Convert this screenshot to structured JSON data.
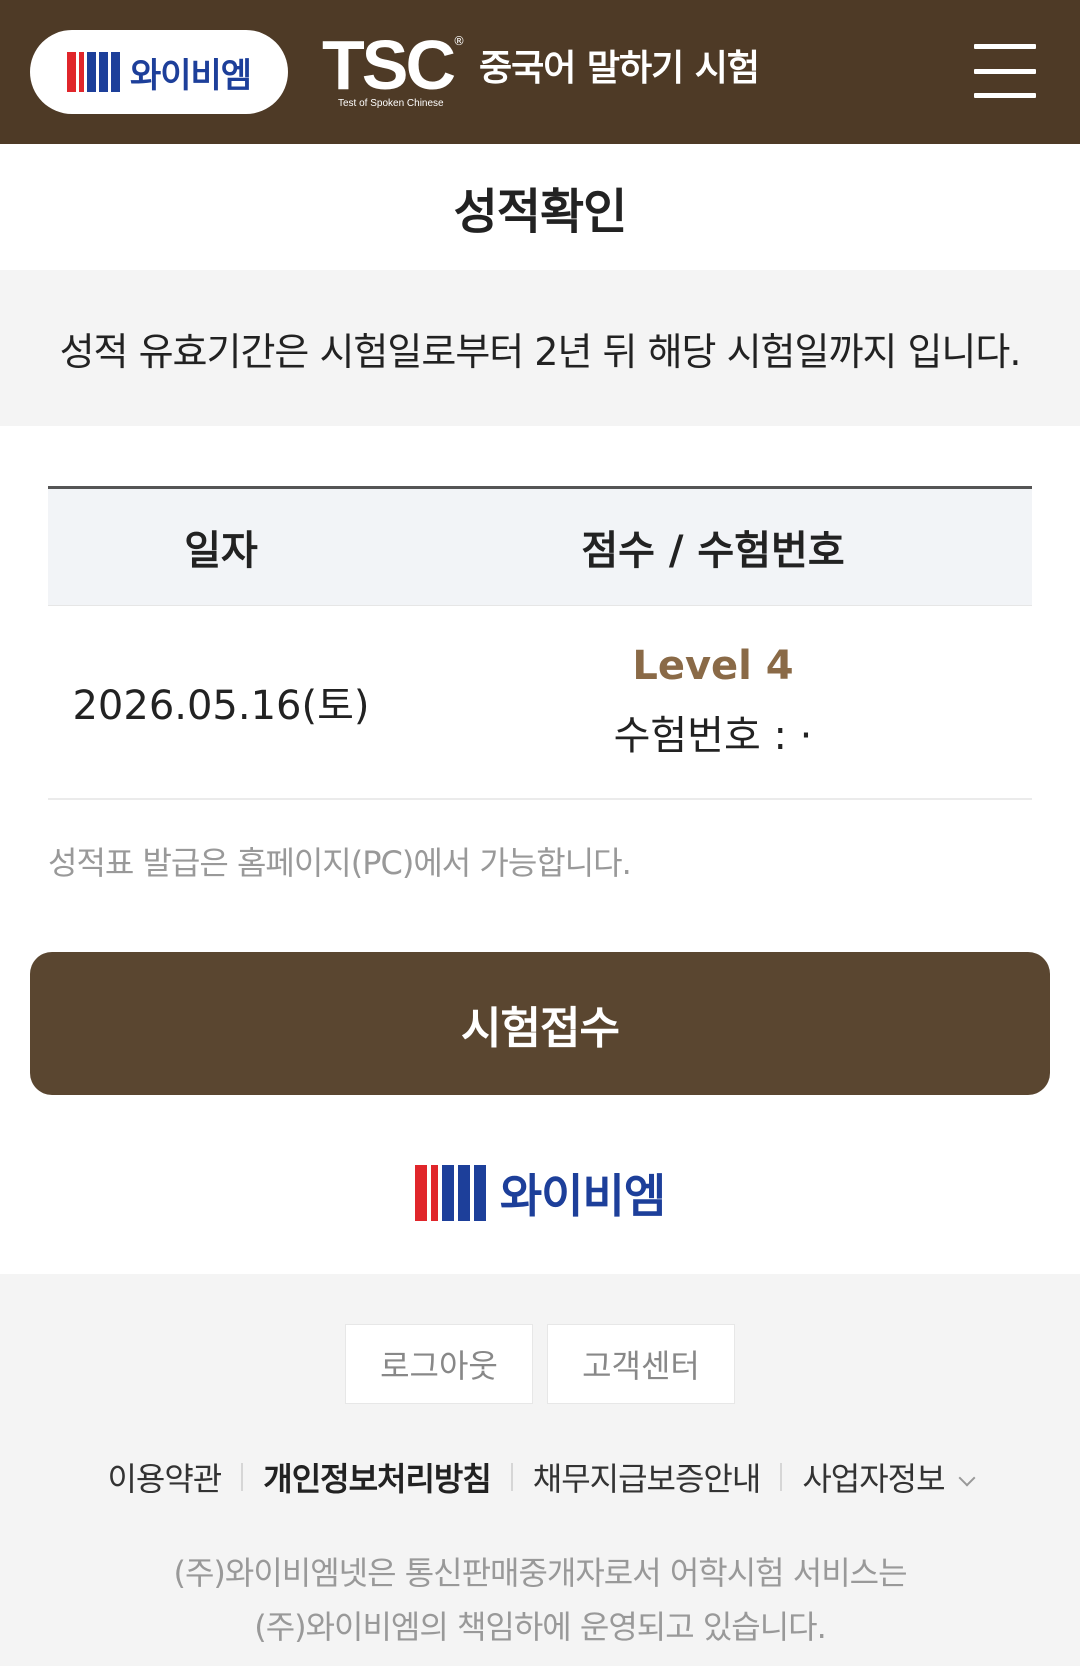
{
  "header": {
    "brand": "와이비엠",
    "tsc_logo": "TSC",
    "tsc_reg": "®",
    "tsc_sub": "Test of Spoken Chinese",
    "title": "중국어 말하기 시험",
    "icon": "hamburger-menu-icon"
  },
  "page": {
    "title": "성적확인",
    "notice": "성적 유효기간은 시험일로부터 2년 뒤 해당 시험일까지 입니다."
  },
  "table": {
    "headers": [
      "일자",
      "점수 / 수험번호"
    ],
    "rows": [
      {
        "date": "2026.05.16(토)",
        "level": "Level 4",
        "exam_no": "수험번호 : ·"
      }
    ]
  },
  "issue_note": "성적표 발급은 홈페이지(PC)에서 가능합니다.",
  "apply_button": "시험접수",
  "footer": {
    "brand": "와이비엠",
    "buttons": [
      "로그아웃",
      "고객센터"
    ],
    "links": [
      "이용약관",
      "개인정보처리방침",
      "채무지급보증안내",
      "사업자정보"
    ],
    "info_line1": "(주)와이비엠넷은 통신판매중개자로서 어학시험 서비스는",
    "info_line2": "(주)와이비엠의 책임하에 운영되고 있습니다."
  },
  "colors": {
    "header_bg": "#4e3a26",
    "button_bg": "#5a4630",
    "level_text": "#8a6a47",
    "ybm_red": "#e0262b",
    "ybm_blue": "#1d3f9a"
  }
}
